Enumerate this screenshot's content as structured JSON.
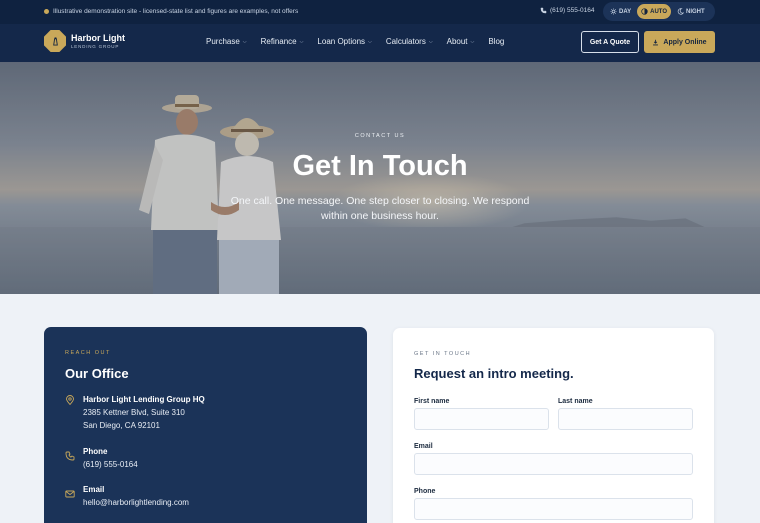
{
  "topbar": {
    "notice": "Illustrative demonstration site - licensed-state list and figures are examples, not offers",
    "phone": "(619) 555-0164",
    "theme_options": [
      {
        "label": "DAY",
        "icon": "sun-icon",
        "active": false
      },
      {
        "label": "AUTO",
        "icon": "contrast-icon",
        "active": true
      },
      {
        "label": "NIGHT",
        "icon": "moon-icon",
        "active": false
      }
    ]
  },
  "brand": {
    "name": "Harbor Light",
    "tagline": "LENDING GROUP"
  },
  "nav": {
    "items": [
      {
        "label": "Purchase",
        "dropdown": true
      },
      {
        "label": "Refinance",
        "dropdown": true
      },
      {
        "label": "Loan Options",
        "dropdown": true
      },
      {
        "label": "Calculators",
        "dropdown": true
      },
      {
        "label": "About",
        "dropdown": true
      },
      {
        "label": "Blog",
        "dropdown": false
      }
    ],
    "quote_label": "Get A Quote",
    "apply_label": "Apply Online"
  },
  "hero": {
    "eyebrow": "CONTACT US",
    "title": "Get In Touch",
    "subtitle": "One call. One message. One step closer to closing. We respond within one business hour."
  },
  "office": {
    "eyebrow": "REACH OUT",
    "title": "Our Office",
    "hq_label": "Harbor Light Lending Group HQ",
    "address_line1": "2385 Kettner Blvd, Suite 310",
    "address_line2": "San Diego, CA 92101",
    "phone_label": "Phone",
    "phone": "(619) 555-0164",
    "email_label": "Email",
    "email": "hello@harborlightlending.com"
  },
  "form": {
    "eyebrow": "GET IN TOUCH",
    "title": "Request an intro meeting.",
    "first_name_label": "First name",
    "last_name_label": "Last name",
    "email_label": "Email",
    "phone_label": "Phone",
    "first_name_value": "",
    "last_name_value": "",
    "email_value": "",
    "phone_value": ""
  },
  "colors": {
    "navy": "#14284a",
    "card_navy": "#1b3358",
    "gold": "#c9a85a",
    "page_bg": "#eef2f7"
  }
}
